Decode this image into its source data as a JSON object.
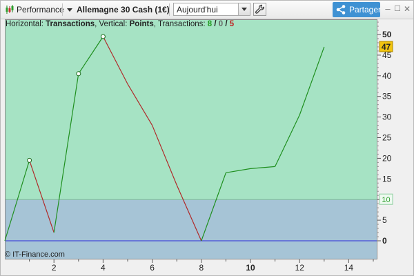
{
  "toolbar": {
    "performance_label": "Performance",
    "instrument_label": "Allemagne 30 Cash (1€)",
    "period_select": {
      "value": "Aujourd'hui"
    },
    "share_label": "Partager",
    "window_buttons": {
      "minimize": "–",
      "maximize": "☐",
      "close": "✕"
    }
  },
  "legend": {
    "horizontal_prefix": "Horizontal: ",
    "horizontal_value": "Transactions",
    "vertical_prefix": ", Vertical: ",
    "vertical_value": "Points",
    "transactions_prefix": ", Transactions: ",
    "count_win": "8",
    "slash1": " / ",
    "count_neutral": "0",
    "slash2": " / ",
    "count_loss": "5"
  },
  "watermark": "© IT-Finance.com",
  "colors": {
    "up_segment": "#1f8f1f",
    "down_segment": "#b02a2a",
    "plot_green": "#a6e3c4",
    "plot_blue": "#a6c4d6",
    "zero_line": "#2a2ad8",
    "last_value_badge": "#f1c40f",
    "threshold_badge_text": "#2e9e2e",
    "share_button": "#3e91d3"
  },
  "chart_data": {
    "type": "line",
    "xlabel": "",
    "ylabel": "",
    "xlim": [
      0,
      15
    ],
    "ylim": [
      -5,
      53
    ],
    "x_ticks": [
      "2",
      "4",
      "6",
      "8",
      "10",
      "12",
      "14"
    ],
    "x_tick_values": [
      2,
      4,
      6,
      8,
      10,
      12,
      14
    ],
    "y_ticks": [
      "0",
      "5",
      "10",
      "15",
      "20",
      "25",
      "30",
      "35",
      "40",
      "45",
      "50"
    ],
    "y_tick_values": [
      0,
      5,
      10,
      15,
      20,
      25,
      30,
      35,
      40,
      45,
      50
    ],
    "threshold": 10,
    "threshold_label": "10",
    "last_value_label": "47",
    "series": [
      {
        "x": [
          0,
          1,
          2,
          3,
          4,
          5,
          6,
          7,
          8,
          9,
          10,
          11,
          12,
          13
        ],
        "y": [
          0,
          19.5,
          2,
          40.5,
          49.5,
          38,
          28,
          13.5,
          0,
          16.5,
          17.5,
          18,
          30.5,
          47
        ]
      }
    ],
    "circle_markers_at_x": [
      1,
      3,
      4
    ]
  }
}
